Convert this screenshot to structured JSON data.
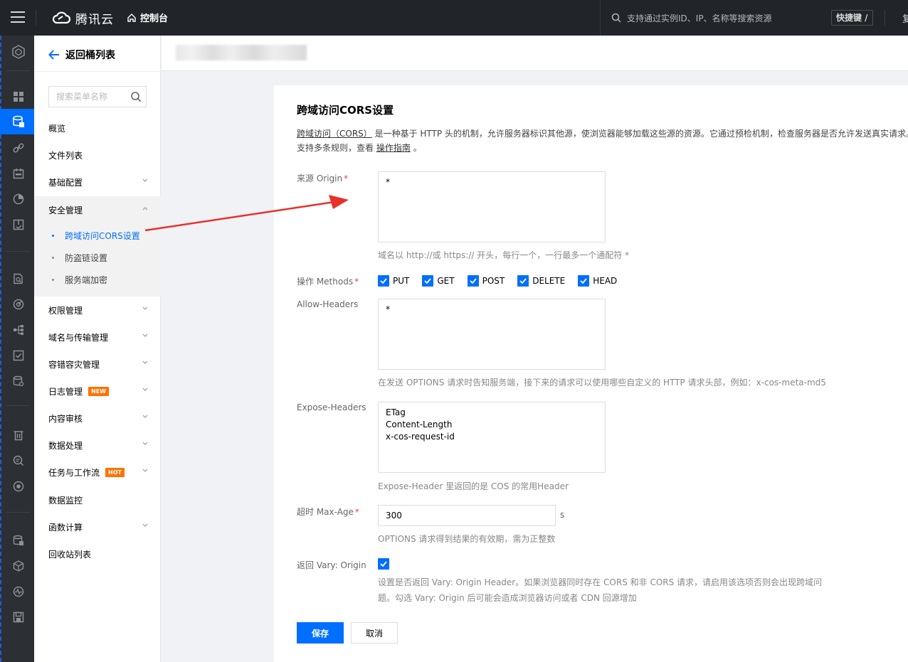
{
  "topbar": {
    "logo_text": "腾讯云",
    "console_label": "控制台",
    "search_placeholder": "支持通过实例ID、IP、名称等搜索资源",
    "shortcut_label": "快捷键 /",
    "truncated_text": "复"
  },
  "sidebar": {
    "back_label": "返回桶列表",
    "search_placeholder": "搜索菜单名称",
    "items": [
      {
        "label": "概览"
      },
      {
        "label": "文件列表"
      },
      {
        "label": "基础配置"
      },
      {
        "label": "安全管理"
      },
      {
        "label": "权限管理"
      },
      {
        "label": "域名与传输管理"
      },
      {
        "label": "容错容灾管理"
      },
      {
        "label": "日志管理",
        "badge": "NEW"
      },
      {
        "label": "内容审核"
      },
      {
        "label": "数据处理"
      },
      {
        "label": "任务与工作流",
        "badge": "HOT"
      },
      {
        "label": "数据监控"
      },
      {
        "label": "函数计算"
      },
      {
        "label": "回收站列表"
      }
    ],
    "security_sub": [
      {
        "label": "跨域访问CORS设置",
        "active": true
      },
      {
        "label": "防盗链设置"
      },
      {
        "label": "服务端加密"
      }
    ]
  },
  "form": {
    "title": "跨域访问CORS设置",
    "desc_link1": "跨域访问（CORS）",
    "desc_text1": " 是一种基于 HTTP 头的机制，允许服务器标识其他源，使浏览器能够加载这些源的资源。它通过预检机制，检查服务器是否允许发送真实请求。",
    "desc_text2": "支持多条规则，查看 ",
    "desc_link2": "操作指南",
    "desc_text3": " 。",
    "origin_label": "来源 Origin",
    "origin_value": "*",
    "origin_help": "域名以 http://或 https:// 开头，每行一个，一行最多一个通配符 *",
    "methods_label": "操作 Methods",
    "methods": [
      "PUT",
      "GET",
      "POST",
      "DELETE",
      "HEAD"
    ],
    "allow_headers_label": "Allow-Headers",
    "allow_headers_value": "*",
    "allow_headers_help": "在发送 OPTIONS 请求时告知服务端，接下来的请求可以使用哪些自定义的 HTTP 请求头部，例如：x-cos-meta-md5",
    "expose_headers_label": "Expose-Headers",
    "expose_headers_value": "ETag\nContent-Length\nx-cos-request-id",
    "expose_headers_help": "Expose-Header 里返回的是 COS 的常用Header",
    "max_age_label": "超时 Max-Age",
    "max_age_value": "300",
    "max_age_unit": "s",
    "max_age_help": "OPTIONS 请求得到结果的有效期，需为正整数",
    "vary_label": "返回 Vary: Origin",
    "vary_help_line1": "设置是否返回 Vary: Origin Header。如果浏览器同时存在 CORS 和非 CORS 请求，请启用该选项否则会出现跨域问",
    "vary_help_line2": "题。勾选 Vary: Origin 后可能会造成浏览器访问或者 CDN 回源增加",
    "save_label": "保存",
    "cancel_label": "取消",
    "required_mark": "*"
  },
  "colors": {
    "primary": "#006eff",
    "topbar": "#212529",
    "rail": "#2c2f33",
    "annotation_arrow": "#e8312a",
    "badge": "#ff7200"
  },
  "icons": {
    "rail": [
      "hexagon-icon",
      "dashboard-icon",
      "storage-icon",
      "link-icon",
      "calendar-icon",
      "pie-chart-icon",
      "inventory-icon",
      "doc-search-icon",
      "radar-icon",
      "flow-icon",
      "checklist-icon",
      "db-settings-icon",
      "trash-icon",
      "search-doc-icon",
      "target-icon",
      "db-doc-icon",
      "cube-icon",
      "pulse-icon",
      "save-box-icon"
    ]
  }
}
